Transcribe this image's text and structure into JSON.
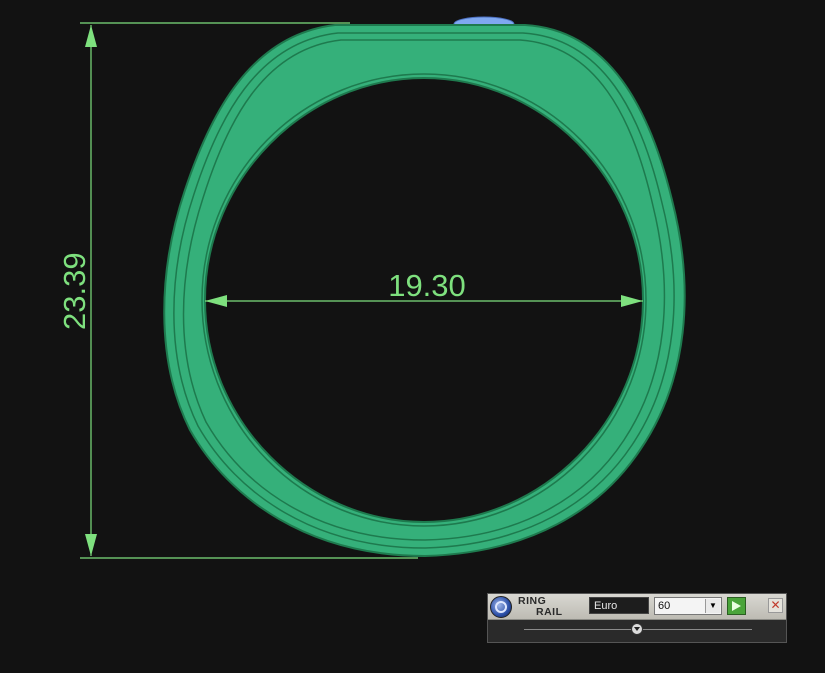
{
  "dimensions": {
    "height_value": "23.39",
    "inner_diameter_value": "19.30"
  },
  "colors": {
    "background": "#121212",
    "ring_body": "#35b07a",
    "ring_edge": "#1e7a4e",
    "dimension_lines": "#7ee07e",
    "gem": "#7fa8f0"
  },
  "ring_rail": {
    "title_line1": "RING",
    "title_line2": "RAIL",
    "size_system": "Euro",
    "size_value": "60",
    "icons": {
      "logo": "ring-rail-logo-icon",
      "play": "play-icon",
      "close": "close-icon",
      "dropdown": "chevron-down-icon",
      "slider": "slider-knob-icon"
    }
  }
}
